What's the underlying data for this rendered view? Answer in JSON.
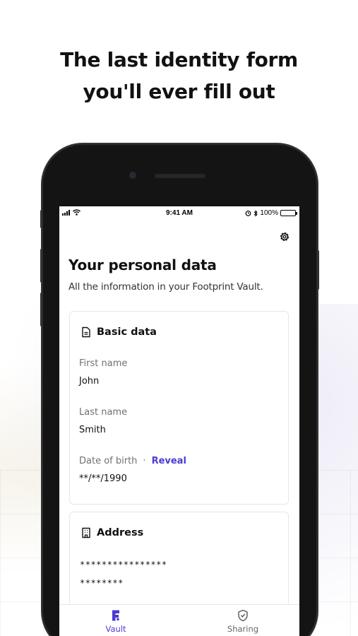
{
  "headline": {
    "line1": "The last identity form",
    "line2": "you'll ever fill out"
  },
  "status_bar": {
    "time": "9:41 AM",
    "battery": "100%",
    "battery_level": 1.0
  },
  "page": {
    "title": "Your personal data",
    "subtitle": "All the information in your Footprint Vault."
  },
  "basic_data": {
    "title": "Basic data",
    "first_name_label": "First name",
    "first_name_value": "John",
    "last_name_label": "Last name",
    "last_name_value": "Smith",
    "dob_label": "Date of birth",
    "dob_separator": "·",
    "dob_reveal": "Reveal",
    "dob_value": "**/**/1990"
  },
  "address": {
    "title": "Address",
    "line1": "****************",
    "line2": "********"
  },
  "tabs": [
    {
      "label": "Vault",
      "icon": "footprint-logo-icon",
      "active": true
    },
    {
      "label": "Sharing",
      "icon": "shield-check-icon",
      "active": false
    }
  ],
  "colors": {
    "accent": "#4a3bd1",
    "text": "#111111",
    "muted": "#707070"
  }
}
